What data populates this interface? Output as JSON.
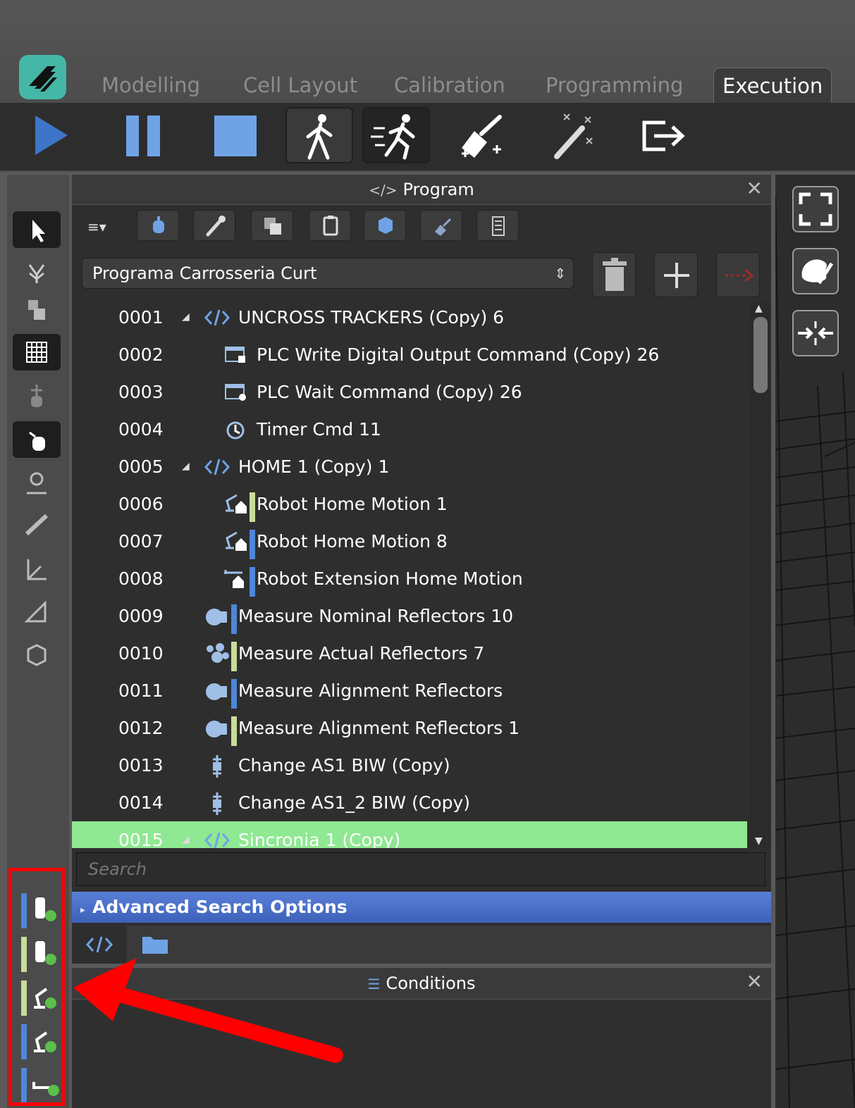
{
  "tabs": [
    {
      "label": "Modelling",
      "active": false
    },
    {
      "label": "Cell Layout",
      "active": false
    },
    {
      "label": "Calibration",
      "active": false
    },
    {
      "label": "Programming",
      "active": false
    },
    {
      "label": "Execution",
      "active": true
    }
  ],
  "toolbar": {
    "buttons": [
      "play-icon",
      "pause-icon",
      "stop-icon",
      "walk-icon",
      "run-icon",
      "clean-icon",
      "magic-wand-icon",
      "exit-icon"
    ]
  },
  "program_panel": {
    "title": "Program",
    "title_icon": "</>",
    "close": "✕",
    "menu_glyph": "≡▾",
    "selected_program": "Programa Carrosseria Curt",
    "select_arrows": "⇕",
    "rows": [
      {
        "num": "0001",
        "expand": "◢",
        "icon": "code-icon",
        "label": "UNCROSS TRACKERS (Copy) 6",
        "indent": 0,
        "color_bar": ""
      },
      {
        "num": "0002",
        "expand": "",
        "icon": "plc-write-icon",
        "label": "PLC Write Digital Output Command (Copy) 26",
        "indent": 1,
        "color_bar": ""
      },
      {
        "num": "0003",
        "expand": "",
        "icon": "plc-wait-icon",
        "label": "PLC Wait Command (Copy) 26",
        "indent": 1,
        "color_bar": ""
      },
      {
        "num": "0004",
        "expand": "",
        "icon": "timer-icon",
        "label": "Timer Cmd 11",
        "indent": 1,
        "color_bar": ""
      },
      {
        "num": "0005",
        "expand": "◢",
        "icon": "code-icon",
        "label": "HOME 1 (Copy) 1",
        "indent": 0,
        "color_bar": ""
      },
      {
        "num": "0006",
        "expand": "",
        "icon": "robot-home-icon",
        "label": "Robot Home Motion 1",
        "indent": 1,
        "color_bar": "#c8dc9a"
      },
      {
        "num": "0007",
        "expand": "",
        "icon": "robot-home-icon",
        "label": "Robot Home Motion 8",
        "indent": 1,
        "color_bar": "#4f86d9"
      },
      {
        "num": "0008",
        "expand": "",
        "icon": "extension-home-icon",
        "label": "Robot Extension Home Motion",
        "indent": 1,
        "color_bar": "#4f86d9"
      },
      {
        "num": "0009",
        "expand": "",
        "icon": "camera-icon",
        "label": "Measure Nominal Reflectors 10",
        "indent": 0,
        "color_bar": "#4f86d9"
      },
      {
        "num": "0010",
        "expand": "",
        "icon": "reflectors-icon",
        "label": "Measure Actual Reflectors 7",
        "indent": 0,
        "color_bar": "#c8dc9a"
      },
      {
        "num": "0011",
        "expand": "",
        "icon": "camera-icon",
        "label": "Measure Alignment Reflectors",
        "indent": 0,
        "color_bar": "#4f86d9"
      },
      {
        "num": "0012",
        "expand": "",
        "icon": "camera-icon",
        "label": "Measure Alignment Reflectors 1",
        "indent": 0,
        "color_bar": "#c8dc9a"
      },
      {
        "num": "0013",
        "expand": "",
        "icon": "change-biw-icon",
        "label": "Change AS1 BIW (Copy)",
        "indent": 0,
        "color_bar": ""
      },
      {
        "num": "0014",
        "expand": "",
        "icon": "change-biw-icon",
        "label": "Change AS1_2 BIW (Copy)",
        "indent": 0,
        "color_bar": ""
      },
      {
        "num": "0015",
        "expand": "◢",
        "icon": "code-icon",
        "label": "Sincronia 1 (Copy)",
        "indent": 0,
        "color_bar": "",
        "active": true
      }
    ],
    "search_placeholder": "Search",
    "advanced_search": "Advanced Search Options",
    "advanced_expand": "▸"
  },
  "conditions_panel": {
    "title": "Conditions",
    "title_icon": "☰",
    "close": "✕"
  },
  "devices": [
    {
      "icon": "tracker-icon",
      "bar_color": "#4f86d9"
    },
    {
      "icon": "tracker-icon",
      "bar_color": "#c8dc9a"
    },
    {
      "icon": "robot-arm-icon",
      "bar_color": "#c8dc9a"
    },
    {
      "icon": "robot-arm-icon",
      "bar_color": "#4f86d9"
    },
    {
      "icon": "linear-axis-icon",
      "bar_color": "#4f86d9"
    }
  ],
  "colors": {
    "accent": "#45b7a7",
    "active_row": "#8fe892",
    "advanced_bar": "#3c61b9",
    "annotation": "#ff0000"
  }
}
